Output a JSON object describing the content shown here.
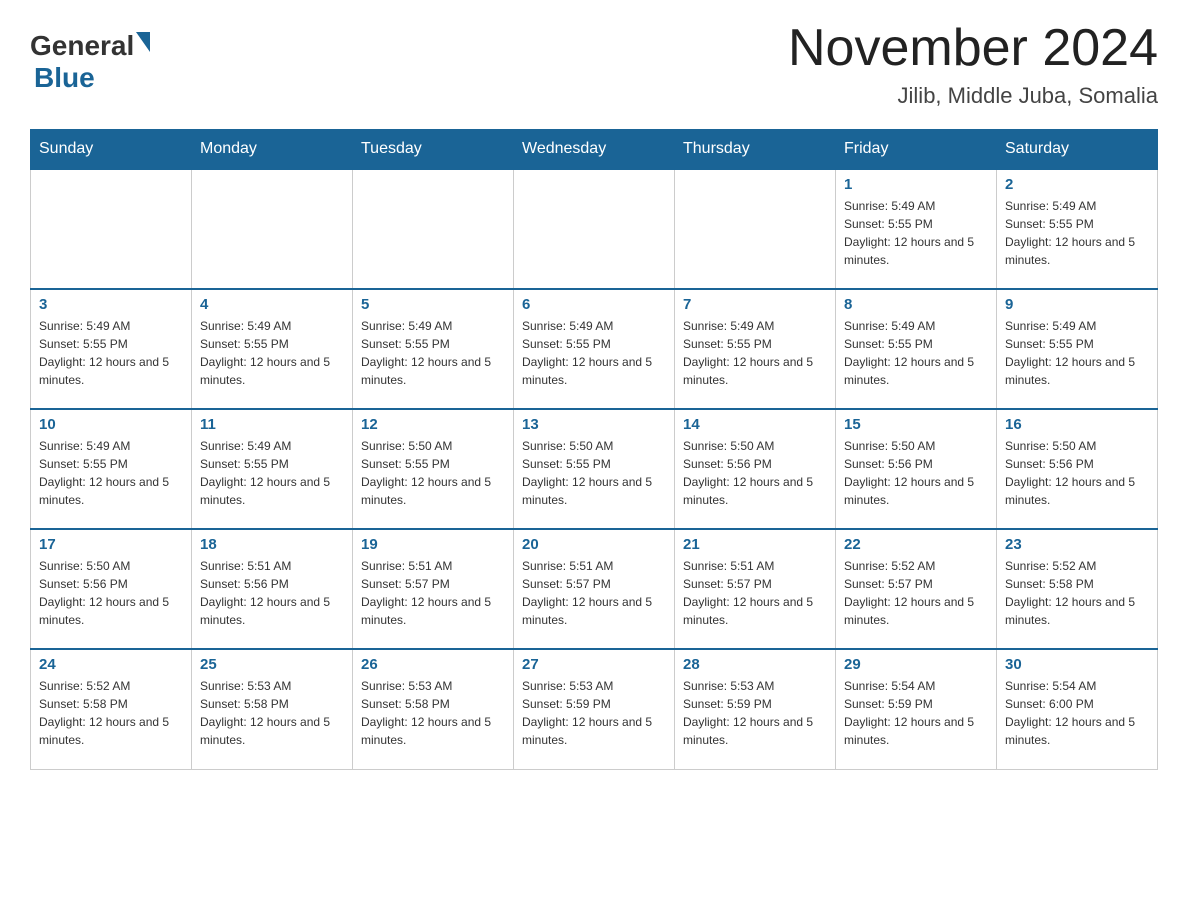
{
  "header": {
    "logo_general": "General",
    "logo_blue": "Blue",
    "month_title": "November 2024",
    "location": "Jilib, Middle Juba, Somalia"
  },
  "calendar": {
    "days_of_week": [
      "Sunday",
      "Monday",
      "Tuesday",
      "Wednesday",
      "Thursday",
      "Friday",
      "Saturday"
    ],
    "weeks": [
      [
        {
          "day": "",
          "info": ""
        },
        {
          "day": "",
          "info": ""
        },
        {
          "day": "",
          "info": ""
        },
        {
          "day": "",
          "info": ""
        },
        {
          "day": "",
          "info": ""
        },
        {
          "day": "1",
          "info": "Sunrise: 5:49 AM\nSunset: 5:55 PM\nDaylight: 12 hours and 5 minutes."
        },
        {
          "day": "2",
          "info": "Sunrise: 5:49 AM\nSunset: 5:55 PM\nDaylight: 12 hours and 5 minutes."
        }
      ],
      [
        {
          "day": "3",
          "info": "Sunrise: 5:49 AM\nSunset: 5:55 PM\nDaylight: 12 hours and 5 minutes."
        },
        {
          "day": "4",
          "info": "Sunrise: 5:49 AM\nSunset: 5:55 PM\nDaylight: 12 hours and 5 minutes."
        },
        {
          "day": "5",
          "info": "Sunrise: 5:49 AM\nSunset: 5:55 PM\nDaylight: 12 hours and 5 minutes."
        },
        {
          "day": "6",
          "info": "Sunrise: 5:49 AM\nSunset: 5:55 PM\nDaylight: 12 hours and 5 minutes."
        },
        {
          "day": "7",
          "info": "Sunrise: 5:49 AM\nSunset: 5:55 PM\nDaylight: 12 hours and 5 minutes."
        },
        {
          "day": "8",
          "info": "Sunrise: 5:49 AM\nSunset: 5:55 PM\nDaylight: 12 hours and 5 minutes."
        },
        {
          "day": "9",
          "info": "Sunrise: 5:49 AM\nSunset: 5:55 PM\nDaylight: 12 hours and 5 minutes."
        }
      ],
      [
        {
          "day": "10",
          "info": "Sunrise: 5:49 AM\nSunset: 5:55 PM\nDaylight: 12 hours and 5 minutes."
        },
        {
          "day": "11",
          "info": "Sunrise: 5:49 AM\nSunset: 5:55 PM\nDaylight: 12 hours and 5 minutes."
        },
        {
          "day": "12",
          "info": "Sunrise: 5:50 AM\nSunset: 5:55 PM\nDaylight: 12 hours and 5 minutes."
        },
        {
          "day": "13",
          "info": "Sunrise: 5:50 AM\nSunset: 5:55 PM\nDaylight: 12 hours and 5 minutes."
        },
        {
          "day": "14",
          "info": "Sunrise: 5:50 AM\nSunset: 5:56 PM\nDaylight: 12 hours and 5 minutes."
        },
        {
          "day": "15",
          "info": "Sunrise: 5:50 AM\nSunset: 5:56 PM\nDaylight: 12 hours and 5 minutes."
        },
        {
          "day": "16",
          "info": "Sunrise: 5:50 AM\nSunset: 5:56 PM\nDaylight: 12 hours and 5 minutes."
        }
      ],
      [
        {
          "day": "17",
          "info": "Sunrise: 5:50 AM\nSunset: 5:56 PM\nDaylight: 12 hours and 5 minutes."
        },
        {
          "day": "18",
          "info": "Sunrise: 5:51 AM\nSunset: 5:56 PM\nDaylight: 12 hours and 5 minutes."
        },
        {
          "day": "19",
          "info": "Sunrise: 5:51 AM\nSunset: 5:57 PM\nDaylight: 12 hours and 5 minutes."
        },
        {
          "day": "20",
          "info": "Sunrise: 5:51 AM\nSunset: 5:57 PM\nDaylight: 12 hours and 5 minutes."
        },
        {
          "day": "21",
          "info": "Sunrise: 5:51 AM\nSunset: 5:57 PM\nDaylight: 12 hours and 5 minutes."
        },
        {
          "day": "22",
          "info": "Sunrise: 5:52 AM\nSunset: 5:57 PM\nDaylight: 12 hours and 5 minutes."
        },
        {
          "day": "23",
          "info": "Sunrise: 5:52 AM\nSunset: 5:58 PM\nDaylight: 12 hours and 5 minutes."
        }
      ],
      [
        {
          "day": "24",
          "info": "Sunrise: 5:52 AM\nSunset: 5:58 PM\nDaylight: 12 hours and 5 minutes."
        },
        {
          "day": "25",
          "info": "Sunrise: 5:53 AM\nSunset: 5:58 PM\nDaylight: 12 hours and 5 minutes."
        },
        {
          "day": "26",
          "info": "Sunrise: 5:53 AM\nSunset: 5:58 PM\nDaylight: 12 hours and 5 minutes."
        },
        {
          "day": "27",
          "info": "Sunrise: 5:53 AM\nSunset: 5:59 PM\nDaylight: 12 hours and 5 minutes."
        },
        {
          "day": "28",
          "info": "Sunrise: 5:53 AM\nSunset: 5:59 PM\nDaylight: 12 hours and 5 minutes."
        },
        {
          "day": "29",
          "info": "Sunrise: 5:54 AM\nSunset: 5:59 PM\nDaylight: 12 hours and 5 minutes."
        },
        {
          "day": "30",
          "info": "Sunrise: 5:54 AM\nSunset: 6:00 PM\nDaylight: 12 hours and 5 minutes."
        }
      ]
    ]
  }
}
